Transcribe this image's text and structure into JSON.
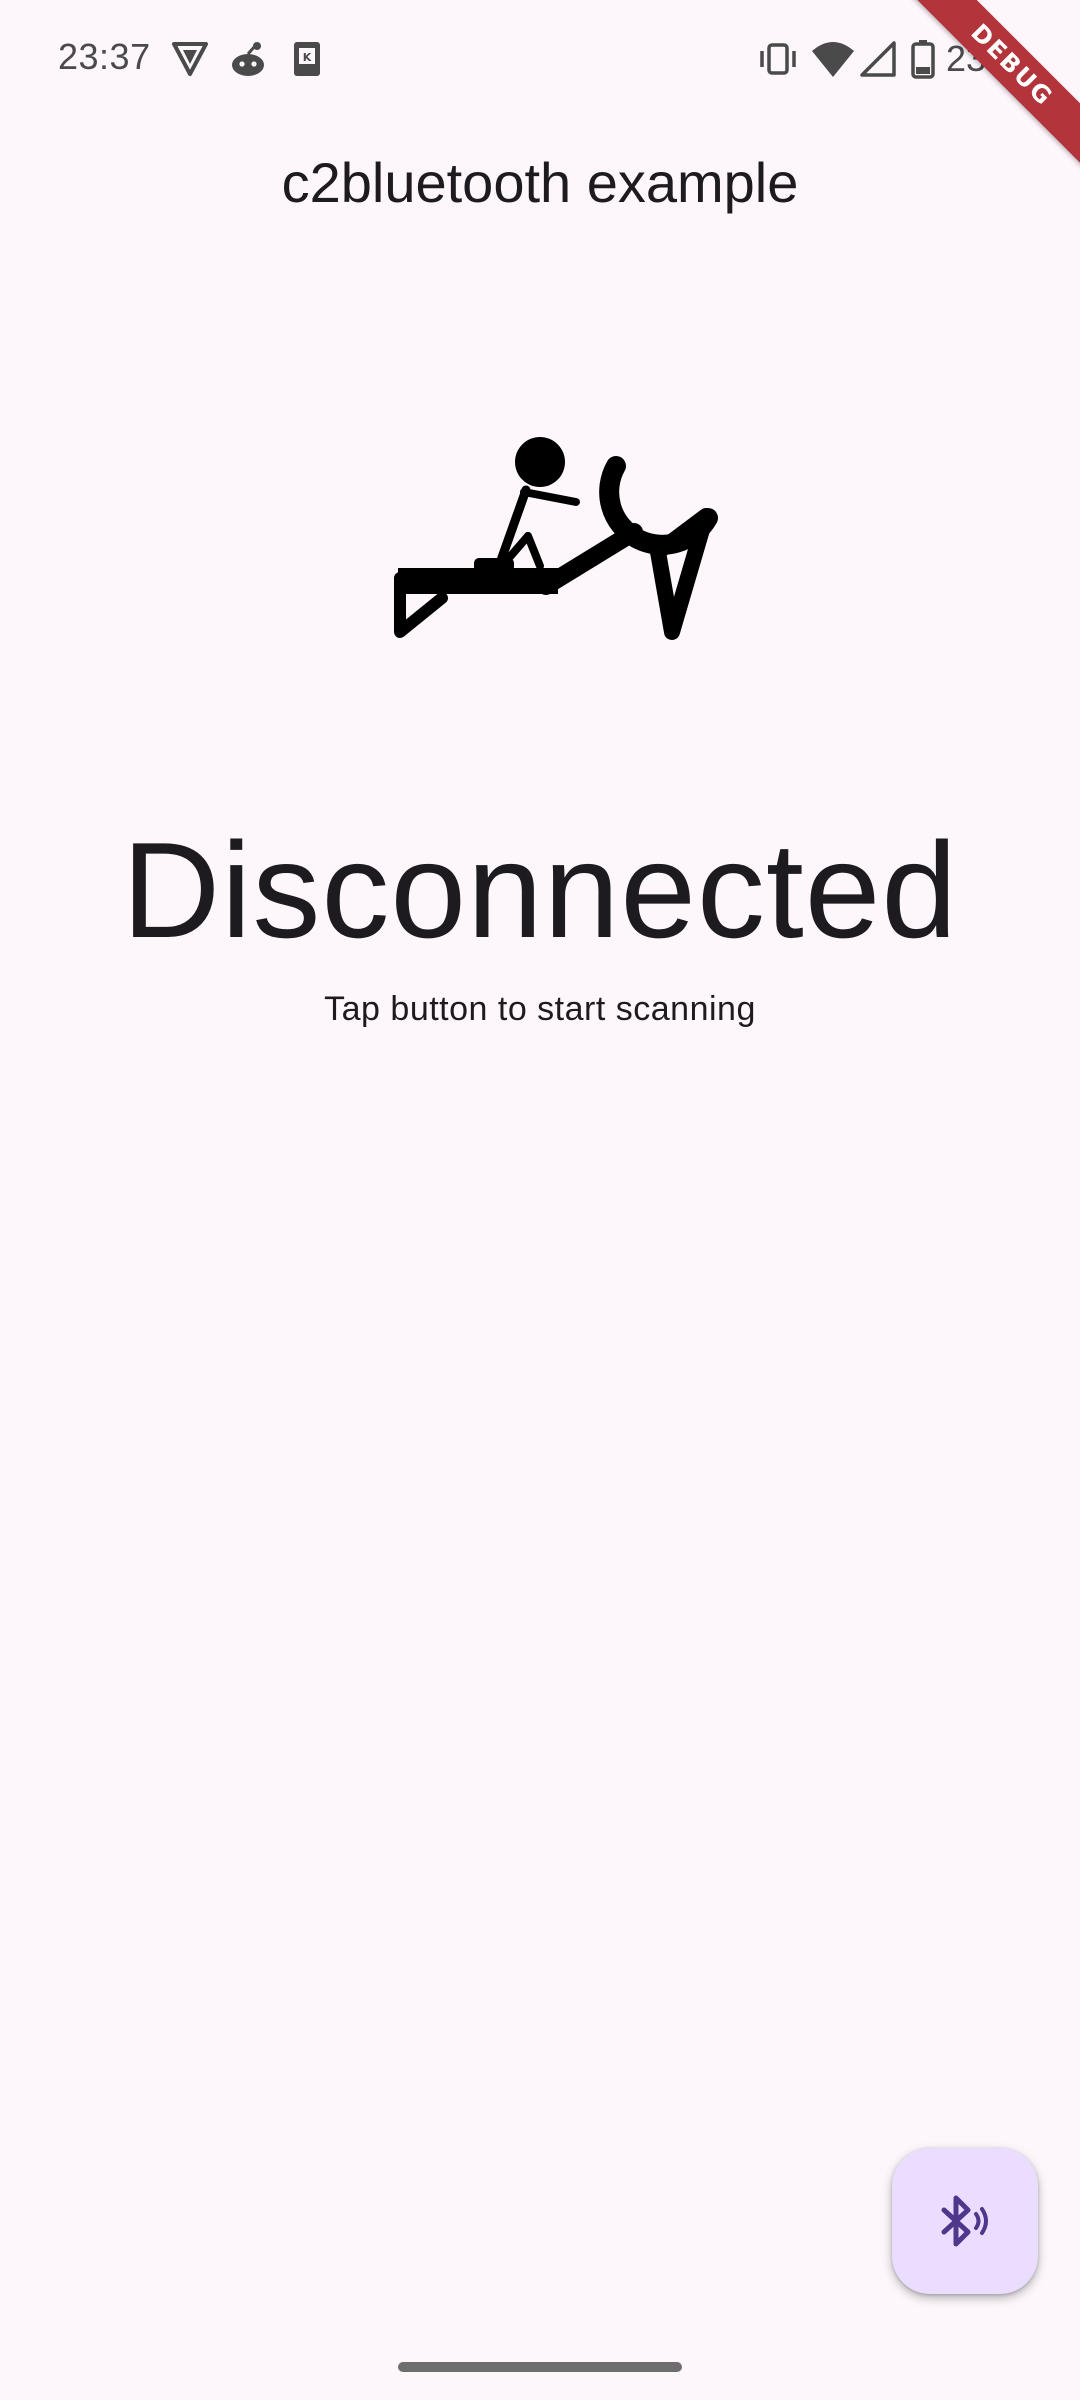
{
  "status_bar": {
    "time": "23:37",
    "battery": "23 %",
    "left_icons": [
      "vpn-shield-icon",
      "reddit-icon",
      "kindle-icon"
    ],
    "right_icons": [
      "vibrate-icon",
      "wifi-icon",
      "signal-icon",
      "battery-icon"
    ]
  },
  "debug_banner": "DEBUG",
  "app_bar": {
    "title": "c2bluetooth example"
  },
  "illustration": {
    "icon": "rowing-machine-icon"
  },
  "connection": {
    "status": "Disconnected",
    "hint": "Tap button to start scanning"
  },
  "fab": {
    "icon": "bluetooth-searching-icon"
  },
  "colors": {
    "background": "#fdf7fc",
    "text": "#1d1b20",
    "fab_background": "#eaddff",
    "fab_icon": "#4f378b",
    "debug_banner": "#b3343a"
  }
}
